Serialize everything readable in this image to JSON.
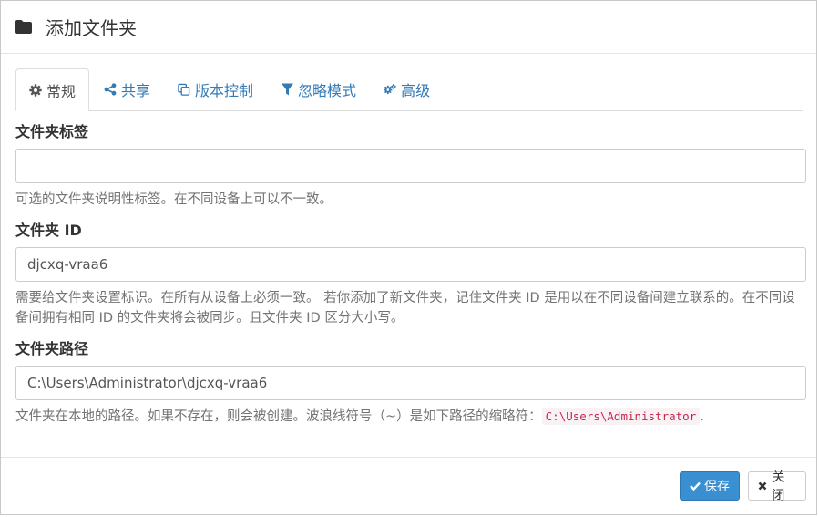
{
  "dialog": {
    "title": "添加文件夹",
    "title_icon": "folder-icon"
  },
  "tabs": [
    {
      "label": "常规",
      "icon": "gear-icon",
      "active": true
    },
    {
      "label": "共享",
      "icon": "share-icon",
      "active": false
    },
    {
      "label": "版本控制",
      "icon": "copy-icon",
      "active": false
    },
    {
      "label": "忽略模式",
      "icon": "filter-icon",
      "active": false
    },
    {
      "label": "高级",
      "icon": "gears-icon",
      "active": false
    }
  ],
  "fields": {
    "folder_label": {
      "label": "文件夹标签",
      "value": "",
      "help": "可选的文件夹说明性标签。在不同设备上可以不一致。"
    },
    "folder_id": {
      "label": "文件夹 ID",
      "value": "djcxq-vraa6",
      "help": "需要给文件夹设置标识。在所有从设备上必须一致。 若你添加了新文件夹，记住文件夹 ID 是用以在不同设备间建立联系的。在不同设备间拥有相同 ID 的文件夹将会被同步。且文件夹 ID 区分大小写。"
    },
    "folder_path": {
      "label": "文件夹路径",
      "value": "C:\\Users\\Administrator\\djcxq-vraa6",
      "help_prefix": "文件夹在本地的路径。如果不存在，则会被创建。波浪线符号（~）是如下路径的缩略符：",
      "help_code": "C:\\Users\\Administrator",
      "help_suffix": "."
    }
  },
  "footer": {
    "save_label": "保存",
    "close_label": "关闭"
  },
  "colors": {
    "link": "#337ab7",
    "primary": "#3a8fd0",
    "code": "#c7254e"
  }
}
